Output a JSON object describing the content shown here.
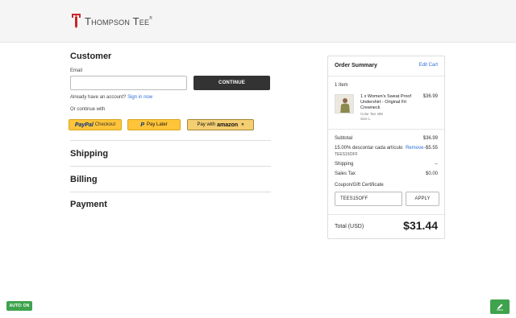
{
  "brand": {
    "name": "Thompson Tee",
    "reg": "®"
  },
  "customer": {
    "title": "Customer",
    "email_label": "Email",
    "email_value": "",
    "continue_label": "CONTINUE",
    "account_prompt": "Already have an account?",
    "signin_label": "Sign in now",
    "continue_with": "Or continue with"
  },
  "payment_buttons": {
    "paypal_brand": "PayPal",
    "paypal_label": "Checkout",
    "paylater_label": "Pay Later",
    "amazon_prefix": "Pay with",
    "amazon_brand": "amazon"
  },
  "steps": {
    "shipping": "Shipping",
    "billing": "Billing",
    "payment": "Payment"
  },
  "order_summary": {
    "title": "Order Summary",
    "edit_cart": "Edit Cart",
    "item_count": "1 Item",
    "item": {
      "name": "1 x Women's Sweat Proof Undershirt - Original Fit Crewneck",
      "price": "$36.99",
      "color": "Color Tan 499",
      "size": "Size L"
    },
    "subtotal_label": "Subtotal",
    "subtotal_value": "$36.99",
    "discount_label": "15.00% descontar cada artículo",
    "discount_remove": "Remove",
    "discount_value": "-$5.55",
    "discount_code": "TEES15OFF",
    "shipping_label": "Shipping",
    "shipping_value": "--",
    "tax_label": "Sales Tax",
    "tax_value": "$0.00",
    "coupon_label": "Coupon/Gift Certificate",
    "coupon_value": "TEES15OFF",
    "apply_label": "APPLY",
    "total_label": "Total (USD)",
    "total_value": "$31.44"
  },
  "badges": {
    "auto": "AUTO: ON"
  },
  "colors": {
    "accent_red": "#c8262c",
    "link_blue": "#2a6fdb",
    "dark_button": "#333333",
    "green": "#3fa34d",
    "paypal_yellow": "#ffc439"
  }
}
